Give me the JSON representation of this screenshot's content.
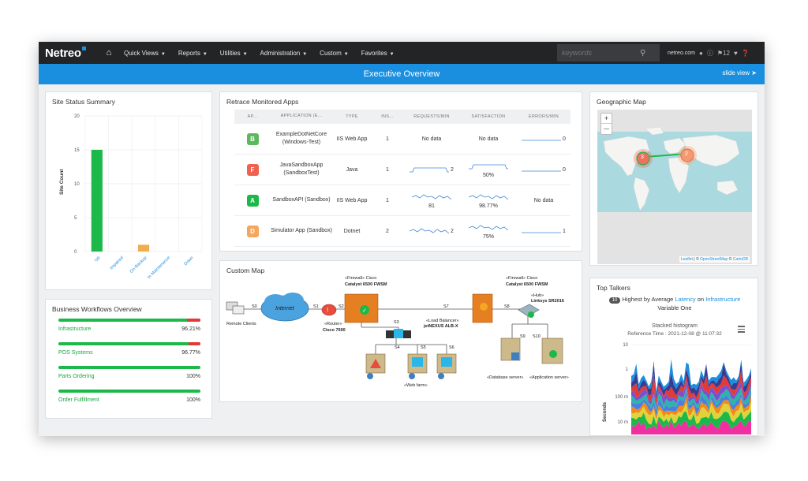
{
  "nav": {
    "logo": "Netreo",
    "items": [
      {
        "label": "Quick Views"
      },
      {
        "label": "Reports"
      },
      {
        "label": "Utilities"
      },
      {
        "label": "Administration"
      },
      {
        "label": "Custom"
      },
      {
        "label": "Favorites"
      }
    ],
    "search_placeholder": "keywords",
    "domain": "netreo.com",
    "alert_count": "12"
  },
  "banner": {
    "title": "Executive Overview",
    "slide_view": "slide view"
  },
  "site_status": {
    "title": "Site Status Summary",
    "chart_data": {
      "type": "bar",
      "categories": [
        "Up",
        "Impaired",
        "On-Backup",
        "In Maintenance",
        "Down"
      ],
      "values": [
        15,
        0,
        1,
        0,
        0
      ],
      "colors": [
        "#1cb94a",
        "#f0ad4e",
        "#f0ad4e",
        "#1a8fe0",
        "#e53935"
      ],
      "ylabel": "Site Count",
      "ylim": [
        0,
        20
      ],
      "yticks": [
        "0",
        "5",
        "10",
        "15",
        "20"
      ]
    }
  },
  "workflows": {
    "title": "Business Workflows Overview",
    "items": [
      {
        "name": "Infrastructure",
        "pct": "96.21%",
        "value": 0.9621
      },
      {
        "name": "POS Systems",
        "pct": "96.77%",
        "value": 0.9677
      },
      {
        "name": "Parts Ordering",
        "pct": "100%",
        "value": 1.0
      },
      {
        "name": "Order Fulfillment",
        "pct": "100%",
        "value": 1.0
      }
    ]
  },
  "retrace": {
    "title": "Retrace Monitored Apps",
    "headers": [
      "AP...",
      "APPLICATION (E...",
      "TYPE",
      "INS...",
      "REQUESTS/MIN",
      "SATISFACTION",
      "ERRORS/MIN"
    ],
    "rows": [
      {
        "grade": "B",
        "grade_color": "#5cb85c",
        "app": "ExampleDotNetCore (Windows-Test)",
        "type": "IIS Web App",
        "instances": "1",
        "requests": "No data",
        "req_spark": false,
        "satisfaction": "No data",
        "sat_spark": false,
        "errors": "0",
        "err_spark": true
      },
      {
        "grade": "F",
        "grade_color": "#f0614f",
        "app": "JavaSandboxApp (SandboxTest)",
        "type": "Java",
        "instances": "1",
        "requests": "2",
        "req_spark": true,
        "satisfaction": "50%",
        "sat_spark": true,
        "errors": "0",
        "err_spark": true
      },
      {
        "grade": "A",
        "grade_color": "#1cb94a",
        "app": "SandboxAPI (Sandbox)",
        "type": "IIS Web App",
        "instances": "1",
        "requests": "81",
        "req_spark": true,
        "satisfaction": "98.77%",
        "sat_spark": true,
        "errors": "No data",
        "err_spark": false
      },
      {
        "grade": "D",
        "grade_color": "#f6a55c",
        "app": "Simulator App (Sandbox)",
        "type": "Dotnet",
        "instances": "2",
        "requests": "2",
        "req_spark": true,
        "satisfaction": "75%",
        "sat_spark": true,
        "errors": "1",
        "err_spark": true
      }
    ]
  },
  "custom_map": {
    "title": "Custom Map",
    "labels": {
      "s0": "S0",
      "s1": "S1",
      "s2": "S2",
      "s3": "S3",
      "s4": "S4",
      "s5": "S5",
      "s6": "S6",
      "s7": "S7",
      "s8": "S8",
      "s9": "S9",
      "s10": "S10",
      "remote": "Remote Clients",
      "internet": "Internet",
      "fw1_stereo": "«Firewall» Cisco",
      "fw1_name": "Catalyst 6500 FWSM",
      "fw2_stereo": "«Firewall» Cisco",
      "fw2_name": "Catalyst 6500 FWSM",
      "router_stereo": "«Router»",
      "router_name": "Cisco 7600",
      "lb_stereo": "«Load Balancer»",
      "lb_name": "jetNEXUS ALB-X",
      "hub_stereo": "«Hub»",
      "hub_name": "Linksys SR2016",
      "webfarm": "«Web farm»",
      "dbserver": "«Database server»",
      "appserver": "«Application server»"
    }
  },
  "geo": {
    "title": "Geographic Map",
    "zoom_in": "+",
    "zoom_out": "—",
    "cluster_a": "3",
    "cluster_b": "2",
    "attribution_leaflet": "Leaflet",
    "attribution_sep": " | © ",
    "attribution_osm": "OpenStreetMap",
    "attribution_sep2": " © ",
    "attribution_carto": "CartoDB"
  },
  "talkers": {
    "title": "Top Talkers",
    "count": "10",
    "prefix": "Highest by Average",
    "metric": "Latency",
    "on": "on",
    "category": "Infrastructure",
    "variable": "Variable One",
    "chart_title": "Stacked histogram",
    "reference": "Reference Time : 2021-12-08 @ 11:07:32",
    "ylabel": "Seconds",
    "yticks": [
      "10",
      "1",
      "100 m",
      "10 m"
    ]
  }
}
